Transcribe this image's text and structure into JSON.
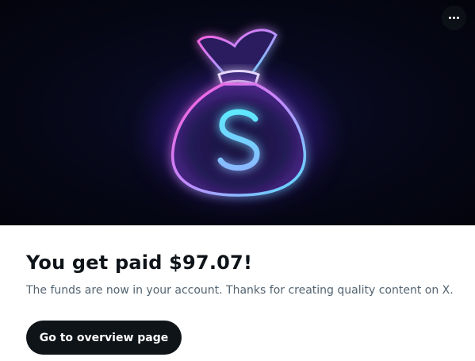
{
  "hero": {
    "image_icon": "money-bag-icon",
    "symbol": "$",
    "colors": {
      "background": "#05061a",
      "neon_pink": "#ff4fd8",
      "neon_purple": "#9b5cff",
      "neon_cyan": "#3fe6ff"
    }
  },
  "menu": {
    "icon": "more-horizontal-icon"
  },
  "message": {
    "headline": "You get paid $97.07!",
    "body": "The funds are now in your account. Thanks for creating quality content on X."
  },
  "actions": {
    "primary_label": "Go to overview page"
  }
}
